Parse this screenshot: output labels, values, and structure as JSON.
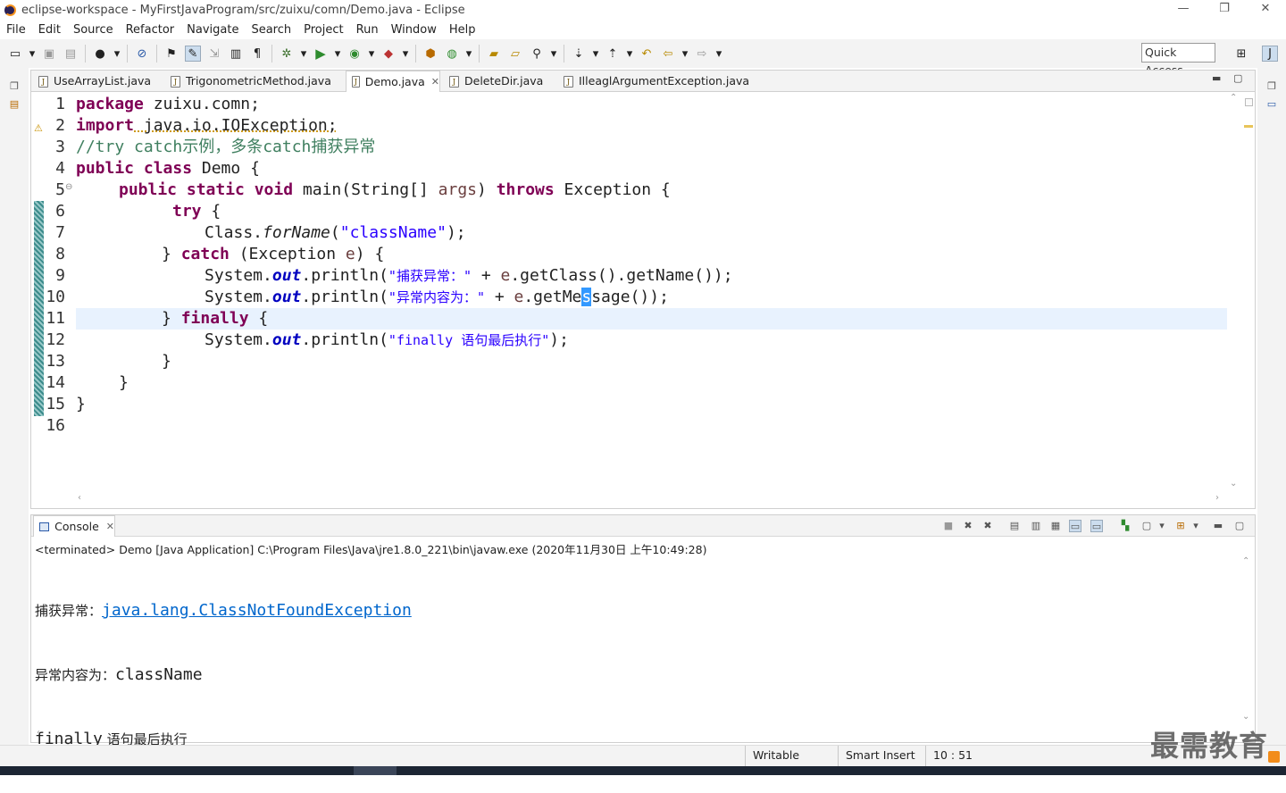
{
  "window": {
    "title": "eclipse-workspace - MyFirstJavaProgram/src/zuixu/comn/Demo.java - Eclipse",
    "min_glyph": "—",
    "max_glyph": "❐",
    "close_glyph": "✕"
  },
  "menu": [
    "File",
    "Edit",
    "Source",
    "Refactor",
    "Navigate",
    "Search",
    "Project",
    "Run",
    "Window",
    "Help"
  ],
  "quick_access": {
    "placeholder": "Quick Access"
  },
  "tabs": [
    {
      "label": "UseArrayList.java",
      "active": false
    },
    {
      "label": "TrigonometricMethod.java",
      "active": false
    },
    {
      "label": "Demo.java",
      "active": true
    },
    {
      "label": "DeleteDir.java",
      "active": false
    },
    {
      "label": "IlleaglArgumentException.java",
      "active": false
    }
  ],
  "editor": {
    "line_numbers": [
      "1",
      "2",
      "3",
      "4",
      "5",
      "6",
      "7",
      "8",
      "9",
      "10",
      "11",
      "12",
      "13",
      "14",
      "15",
      "16"
    ],
    "fold_marker": "⊖",
    "code": {
      "l1_kw": "package",
      "l1_rest": " zuixu.comn;",
      "l2_kw": "import",
      "l2_rest": " java.io.IOException;",
      "l3": "//try catch示例，多条catch捕获异常",
      "l4_kw": "public class",
      "l4_rest": " Demo {",
      "l5_kw": "public static void",
      "l5_a": " main(String[] ",
      "l5_var": "args",
      "l5_b": ") ",
      "l5_kw2": "throws",
      "l5_c": " Exception {",
      "l6_kw": "try",
      "l6_rest": " {",
      "l7_a": "Class.",
      "l7_it": "forName",
      "l7_b": "(",
      "l7_str": "\"className\"",
      "l7_c": ");",
      "l8_a": "} ",
      "l8_kw": "catch",
      "l8_b": " (Exception ",
      "l8_var": "e",
      "l8_c": ") {",
      "l9_a": "System.",
      "l9_fi": "out",
      "l9_b": ".println(",
      "l9_str": "\"捕获异常：\"",
      "l9_c": " + ",
      "l9_var": "e",
      "l9_d": ".getClass().getName());",
      "l10_a": "System.",
      "l10_fi": "out",
      "l10_b": ".println(",
      "l10_str": "\"异常内容为：\"",
      "l10_c": " + ",
      "l10_var": "e",
      "l10_d1": ".getMe",
      "l10_caret": "s",
      "l10_d2": "sage());",
      "l11_a": "} ",
      "l11_kw": "finally",
      "l11_b": " {",
      "l12_a": "System.",
      "l12_fi": "out",
      "l12_b": ".println(",
      "l12_str": "\"finally 语句最后执行\"",
      "l12_c": ");",
      "l13": "}",
      "l14": "}",
      "l15": "}"
    }
  },
  "console": {
    "tab_label": "Console",
    "status": "<terminated> Demo [Java Application] C:\\Program Files\\Java\\jre1.8.0_221\\bin\\javaw.exe (2020年11月30日 上午10:49:28)",
    "out1_prefix": "捕获异常：",
    "out1_link": "java.lang.ClassNotFoundException",
    "out2_prefix": "异常内容为：",
    "out2_value": "className",
    "out3_a": "finally",
    "out3_b": " 语句最后执行"
  },
  "statusbar": {
    "mode": "Writable",
    "insert": "Smart Insert",
    "position": "10 : 51"
  },
  "watermark": "最需教育",
  "colors": {
    "keyword": "#7f0055",
    "comment": "#3f7f5f",
    "string": "#2a00ff",
    "field": "#0000c0",
    "current_line": "#e8f2fe",
    "link": "#0066cc"
  }
}
